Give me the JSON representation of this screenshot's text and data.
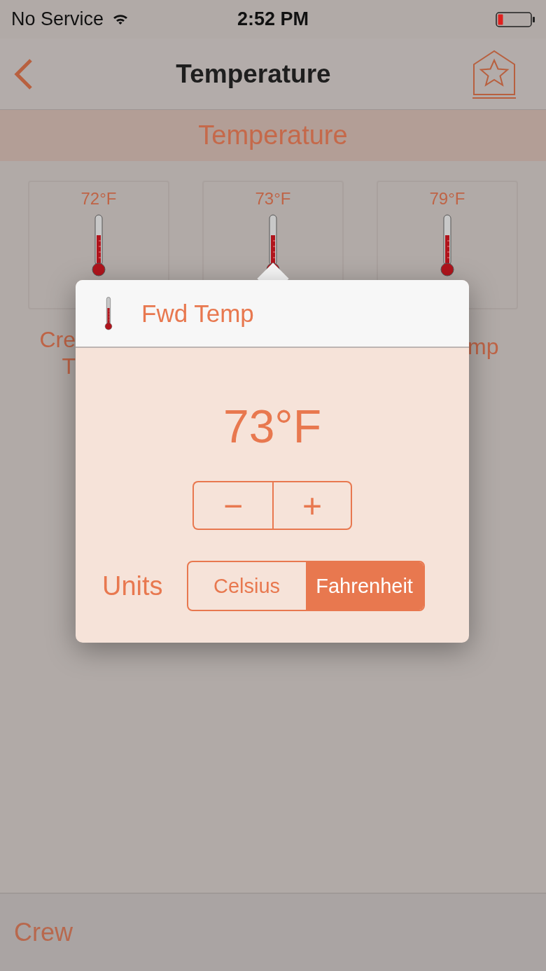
{
  "status_bar": {
    "carrier": "No Service",
    "time": "2:52 PM"
  },
  "nav": {
    "title": "Temperature"
  },
  "section": {
    "title": "Temperature"
  },
  "sensors": [
    {
      "reading": "72°F",
      "label_lines": [
        "Cre",
        "T"
      ]
    },
    {
      "reading": "73°F"
    },
    {
      "reading": "79°F",
      "label_lines": [
        "mp"
      ]
    }
  ],
  "popover": {
    "title": "Fwd Temp",
    "value": "73°F",
    "stepper": [
      "−",
      "+"
    ],
    "units_label": "Units",
    "units": [
      {
        "label": "Celsius",
        "selected": false
      },
      {
        "label": "Fahrenheit",
        "selected": true
      }
    ]
  },
  "tab_bar": {
    "label": "Crew"
  }
}
